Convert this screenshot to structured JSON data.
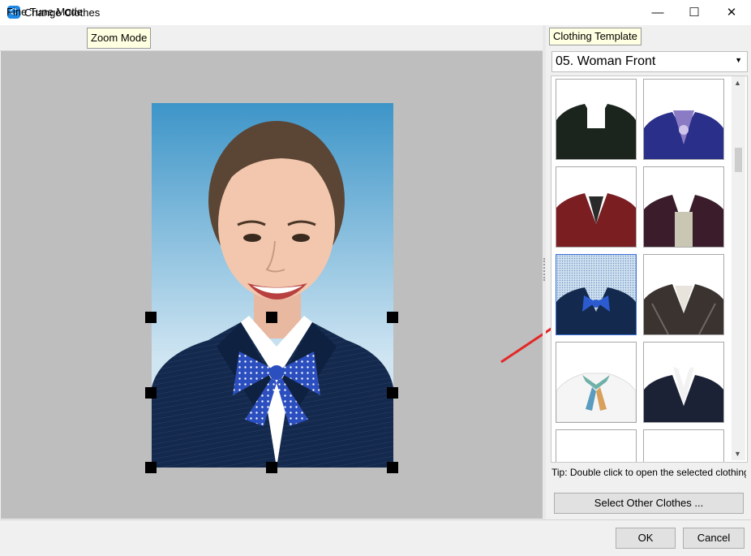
{
  "window": {
    "title": "Change Clothes",
    "minimize": "—",
    "maximize": "☐",
    "close": "✕"
  },
  "left_panel": {
    "modes": [
      "Fine Tune Mode",
      "Zoom Mode"
    ],
    "active_mode": "Zoom Mode"
  },
  "right_panel": {
    "tab_label": "Clothing Template",
    "category": "05. Woman Front",
    "dropdown_icon": "caret-down-icon",
    "templates": [
      {
        "name": "black-sweater",
        "color": "#1b241d"
      },
      {
        "name": "purple-jacket-scarf",
        "color": "#2a2f8a"
      },
      {
        "name": "maroon-blazer",
        "color": "#7a1e22"
      },
      {
        "name": "dark-purple-blazer",
        "color": "#3a1c2b"
      },
      {
        "name": "navy-blazer-blue-bow",
        "color": "#13294d",
        "selected": true
      },
      {
        "name": "plaid-blazer",
        "color": "#3a3330"
      },
      {
        "name": "white-shirt-striped-scarf",
        "color": "#f5f5f5"
      },
      {
        "name": "navy-blazer-white-collar",
        "color": "#1c2236"
      }
    ],
    "tip": "Tip: Double click to open the selected clothing template",
    "select_other_label": "Select Other Clothes ..."
  },
  "footer": {
    "ok_label": "OK",
    "cancel_label": "Cancel"
  },
  "colors": {
    "accent": "#1e88e5",
    "arrow": "#e52626",
    "photo_background_top": "#3d95c8",
    "photo_background_bottom": "#cfe5f2",
    "handle": "#000000"
  }
}
